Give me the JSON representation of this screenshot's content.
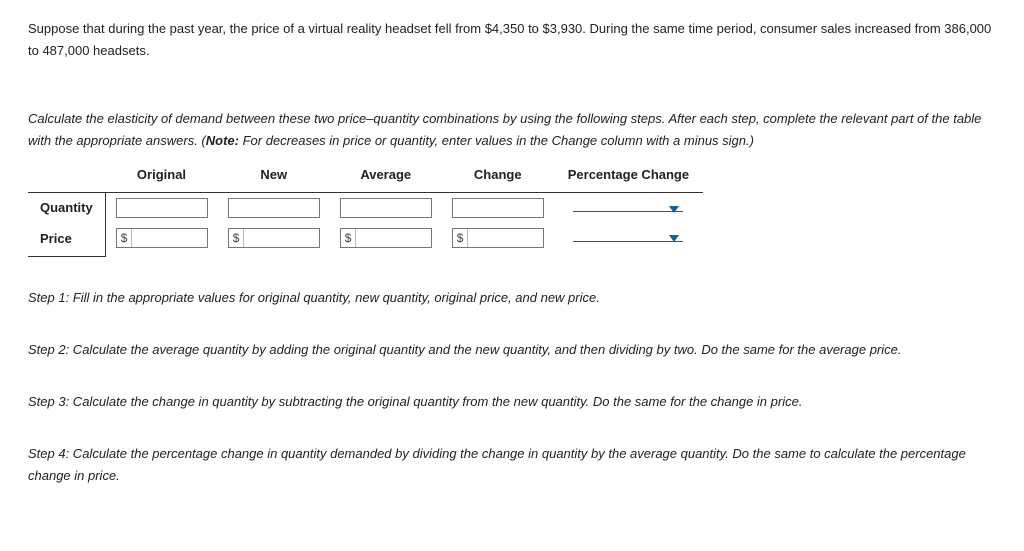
{
  "intro1": "Suppose that during the past year, the price of a virtual reality headset fell from $4,350 to $3,930. During the same time period, consumer sales increased from 386,000 to 487,000 headsets.",
  "instr1": "Calculate the elasticity of demand between these two price–quantity combinations by using the following steps. After each step, complete the relevant part of the table with the appropriate answers. (",
  "noteLabel": "Note:",
  "instr2": " For decreases in price or quantity, enter values in the Change column with a minus sign.)",
  "table": {
    "headers": {
      "original": "Original",
      "new": "New",
      "average": "Average",
      "change": "Change",
      "pct": "Percentage Change"
    },
    "rows": {
      "quantity": "Quantity",
      "price": "Price"
    },
    "currencyPrefix": "$"
  },
  "steps": {
    "s1": "Step 1: Fill in the appropriate values for original quantity, new quantity, original price, and new price.",
    "s2": "Step 2: Calculate the average quantity by adding the original quantity and the new quantity, and then dividing by two. Do the same for the average price.",
    "s3": "Step 3: Calculate the change in quantity by subtracting the original quantity from the new quantity. Do the same for the change in price.",
    "s4": "Step 4: Calculate the percentage change in quantity demanded by dividing the change in quantity by the average quantity. Do the same to calculate the percentage change in price."
  }
}
